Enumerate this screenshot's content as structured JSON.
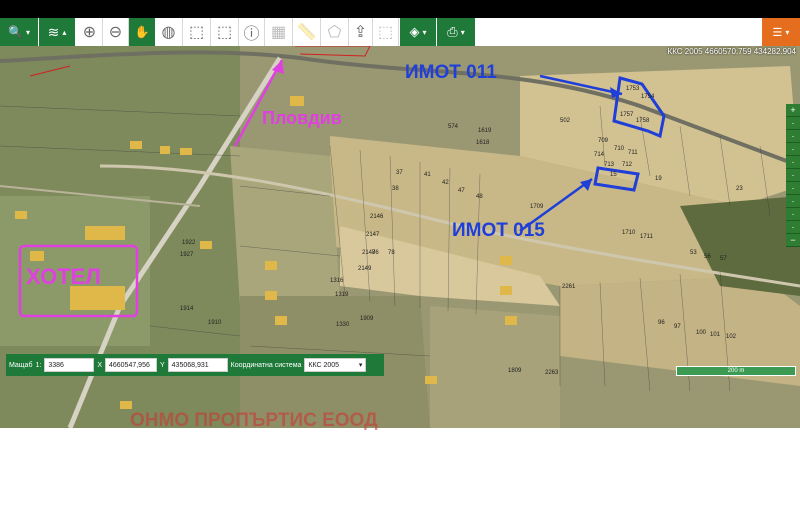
{
  "toolbar": {
    "buttons": [
      {
        "name": "search-icon",
        "glyph": "🔍"
      },
      {
        "name": "layers-icon",
        "glyph": "≋"
      },
      {
        "name": "zoom-in-icon",
        "glyph": "⊕"
      },
      {
        "name": "zoom-out-icon",
        "glyph": "⊖"
      },
      {
        "name": "pan-hand-icon",
        "glyph": "✋"
      },
      {
        "name": "globe-icon",
        "glyph": "◍"
      },
      {
        "name": "select-rect-icon",
        "glyph": "⬚"
      },
      {
        "name": "select-rect-alt-icon",
        "glyph": "⬚"
      },
      {
        "name": "info-icon",
        "glyph": "ⓘ"
      },
      {
        "name": "legend-icon",
        "glyph": "▦"
      },
      {
        "name": "ruler-icon",
        "glyph": "📏"
      },
      {
        "name": "polygon-icon",
        "glyph": "⬠"
      },
      {
        "name": "upload-icon",
        "glyph": "⇪"
      },
      {
        "name": "clear-selection-icon",
        "glyph": "⬚"
      },
      {
        "name": "base-layer-icon",
        "glyph": "◈"
      },
      {
        "name": "print-icon",
        "glyph": "⎙"
      },
      {
        "name": "user-menu-icon",
        "glyph": "☰"
      }
    ]
  },
  "coord_readout": "ККС 2005 4660570.759 434282.904",
  "annotations": {
    "imot_011": "ИМОТ 011",
    "imot_015": "ИМОТ 015",
    "plovdiv": "Пловдив",
    "hotel": "ХОТЕЛ"
  },
  "parcel_numbers": [
    "1753",
    "1754",
    "1757",
    "1758",
    "502",
    "574",
    "1619",
    "1618",
    "709",
    "710",
    "711",
    "712",
    "713",
    "714",
    "15",
    "19",
    "23",
    "1709",
    "1710",
    "1711",
    "2146",
    "2147",
    "2148",
    "2149",
    "96",
    "97",
    "100",
    "101",
    "102",
    "1809",
    "2263",
    "2261",
    "1316",
    "1319",
    "1330",
    "1909",
    "1910",
    "1914",
    "1922",
    "1927",
    "37",
    "38",
    "41",
    "42",
    "47",
    "48",
    "53",
    "56",
    "57",
    "76",
    "78"
  ],
  "panel": {
    "scale_label": "Мащаб",
    "scale_prefix": "1:",
    "scale_value": "3386",
    "x_label": "X",
    "x_value": "4660547,956",
    "y_label": "Y",
    "y_value": "435068,931",
    "cs_label": "Координатна система",
    "cs_value": "ККС 2005"
  },
  "scalebar": "200 m",
  "watermark": "ОНМО ПРОПЪРТИС ЕООД",
  "colors": {
    "toolbar_green": "#1f7a3a",
    "annotation_blue": "#1f3fd8",
    "annotation_magenta": "#e040e0",
    "watermark_red": "#cc3333"
  }
}
